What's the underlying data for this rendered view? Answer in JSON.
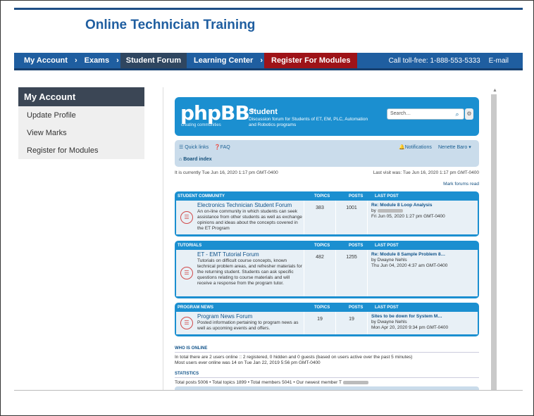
{
  "site": {
    "title": "Online Technician Training"
  },
  "nav": {
    "items": [
      "My Account",
      "Exams",
      "Student Forum",
      "Learning Center",
      "Register For Modules"
    ],
    "sep": "›",
    "phone": "Call toll-free: 1-888-553-5333",
    "email": "E-mail"
  },
  "sidebar": {
    "heading": "My Account",
    "links": [
      "Update Profile",
      "View Marks",
      "Register for Modules"
    ]
  },
  "forum": {
    "logo": "phpBB",
    "logo_reg": "®",
    "logo_sub": "creating   communities",
    "title": "Student",
    "description": "Discussion forum for Students of ET, EM, PLC, Automation and Robotics programs",
    "search_placeholder": "Search…",
    "quick_links": "Quick links",
    "faq": "FAQ",
    "notifications": "Notifications",
    "user": "Nenette Baro",
    "board_index": "Board index",
    "current_time": "It is currently Tue Jun 16, 2020 1:17 pm GMT-0400",
    "last_visit": "Last visit was: Tue Jun 16, 2020 1:17 pm GMT-0400",
    "mark_read": "Mark forums read",
    "col_topics": "TOPICS",
    "col_posts": "POSTS",
    "col_last": "LAST POST",
    "categories": [
      {
        "name": "STUDENT COMMUNITY",
        "forum_title": "Electronics Technician Student Forum",
        "forum_desc": "An on-line community in which students can seek assistance from other students as well as exchange opinions and ideas about the concepts covered in the ET Program",
        "topics": "383",
        "posts": "1001",
        "last_title": "Re: Module 8 Loop Analysis",
        "last_by": "by",
        "last_date": "Fri Jun 05, 2020 1:27 pm GMT-0400"
      },
      {
        "name": "TUTORIALS",
        "forum_title": "ET - EMT Tutorial Forum",
        "forum_desc": "Tutorials on difficult course concepts, known technical problem areas, and refresher materials for the returning student. Students can ask specific questions relating to course materials and will receive a response from the program tutor.",
        "topics": "482",
        "posts": "1255",
        "last_title": "Re: Module 8 Sample Problem 8…",
        "last_by": "by Dwayne Nehls",
        "last_date": "Thu Jun 04, 2020 4:37 am GMT-0400"
      },
      {
        "name": "PROGRAM NEWS",
        "forum_title": "Program News Forum",
        "forum_desc": "Posted information pertaining to program news as well as upcoming events and offers.",
        "topics": "19",
        "posts": "19",
        "last_title": "Sites to be down for System M…",
        "last_by": "by Dwayne Nehls",
        "last_date": "Mon Apr 20, 2020 9:34 pm GMT-0400"
      }
    ],
    "who_online_title": "WHO IS ONLINE",
    "who_online_text": "In total there are 2 users online :: 2 registered, 0 hidden and 0 guests (based on users active over the past 5 minutes)",
    "most_online_text": "Most users ever online was 14 on Tue Jan 22, 2019 5:56 pm GMT-0400",
    "stats_title": "STATISTICS",
    "stats_text": "Total posts 5006 • Total topics 1899 • Total members 5041 • Our newest member T"
  }
}
